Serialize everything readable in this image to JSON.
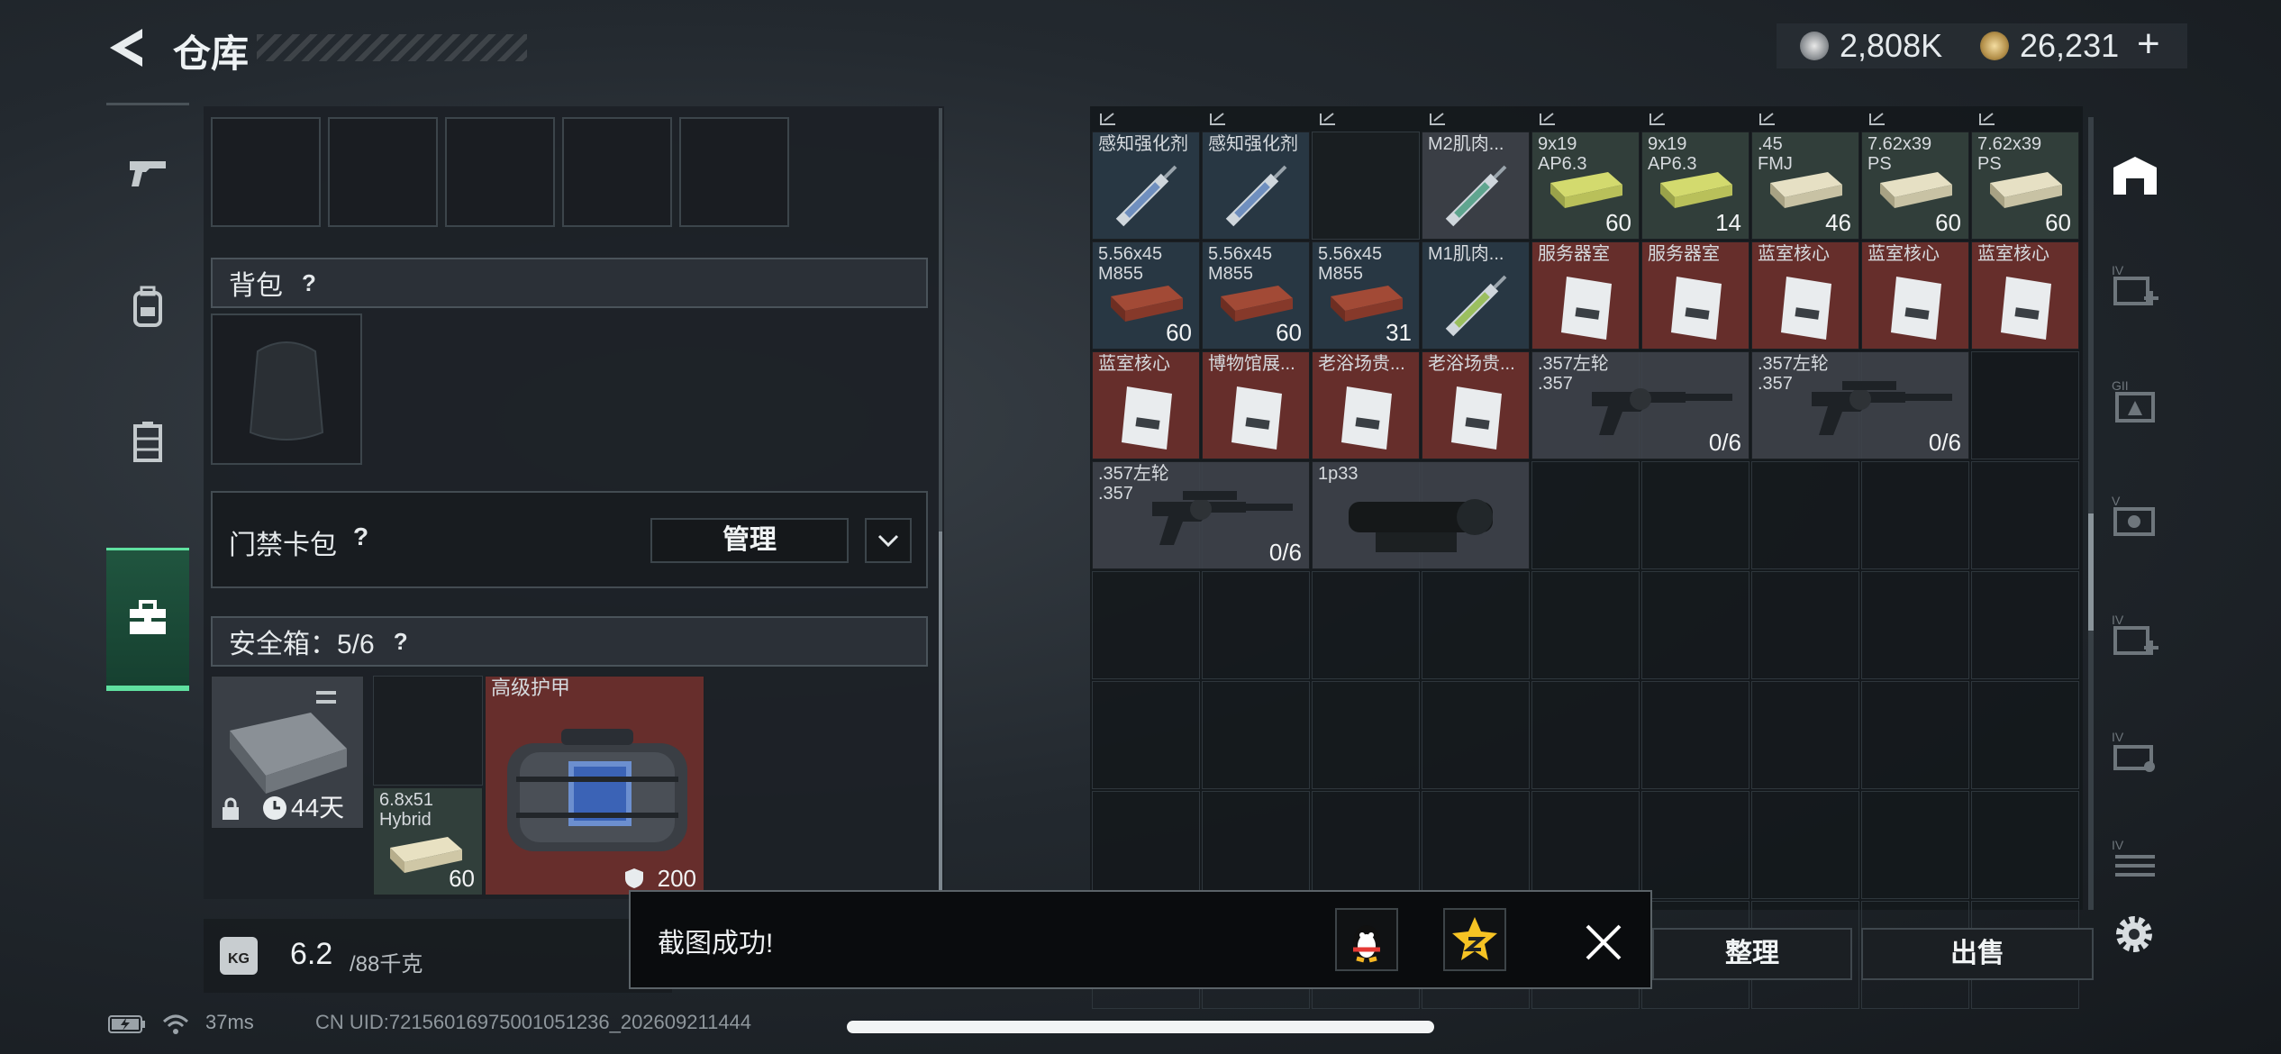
{
  "header": {
    "title": "仓库",
    "silver_amount": "2,808K",
    "gold_amount": "26,231",
    "plus_label": "+"
  },
  "left": {
    "backpack_label": "背包",
    "keycard_label": "门禁卡包",
    "manage_label": "管理",
    "safe_box_label": "安全箱：5/6",
    "question": "?",
    "safe_box_timer": "44天",
    "ammo_name": "6.8x51\nHybrid",
    "ammo_count": "60",
    "armor_name": "高级护甲",
    "armor_value": "200",
    "weight_current": "6.2",
    "weight_max": "/88千克",
    "kg_icon": "KG"
  },
  "grid": {
    "row1": [
      {
        "name": "感知强化剂",
        "count": ""
      },
      {
        "name": "感知强化剂",
        "count": ""
      },
      {
        "name": "",
        "count": ""
      },
      {
        "name": "M2肌肉...",
        "count": ""
      },
      {
        "name": "9x19\nAP6.3",
        "count": "60"
      },
      {
        "name": "9x19\nAP6.3",
        "count": "14"
      },
      {
        "name": ".45\nFMJ",
        "count": "46"
      },
      {
        "name": "7.62x39\nPS",
        "count": "60"
      },
      {
        "name": "7.62x39\nPS",
        "count": "60"
      }
    ],
    "row2": [
      {
        "name": "5.56x45\nM855",
        "count": "60"
      },
      {
        "name": "5.56x45\nM855",
        "count": "60"
      },
      {
        "name": "5.56x45\nM855",
        "count": "31"
      },
      {
        "name": "M1肌肉...",
        "count": ""
      },
      {
        "name": "服务器室",
        "count": ""
      },
      {
        "name": "服务器室",
        "count": ""
      },
      {
        "name": "蓝室核心",
        "count": ""
      },
      {
        "name": "蓝室核心",
        "count": ""
      },
      {
        "name": "蓝室核心",
        "count": ""
      }
    ],
    "row3": [
      {
        "name": "蓝室核心",
        "count": ""
      },
      {
        "name": "博物馆展...",
        "count": ""
      },
      {
        "name": "老浴场贵...",
        "count": ""
      },
      {
        "name": "老浴场贵...",
        "count": ""
      }
    ],
    "revolver1": {
      "name": ".357左轮\n.357",
      "count": "0/6"
    },
    "revolver2": {
      "name": ".357左轮\n.357",
      "count": "0/6"
    },
    "revolver3": {
      "name": ".357左轮\n.357",
      "count": "0/6"
    },
    "scope": {
      "name": "1p33",
      "count": ""
    }
  },
  "actions": {
    "organize_label": "整理",
    "sell_label": "出售"
  },
  "toast": {
    "text": "截图成功!"
  },
  "status": {
    "ping": "37ms",
    "uid": "CN UID:72156016975001051236_202609211444"
  }
}
